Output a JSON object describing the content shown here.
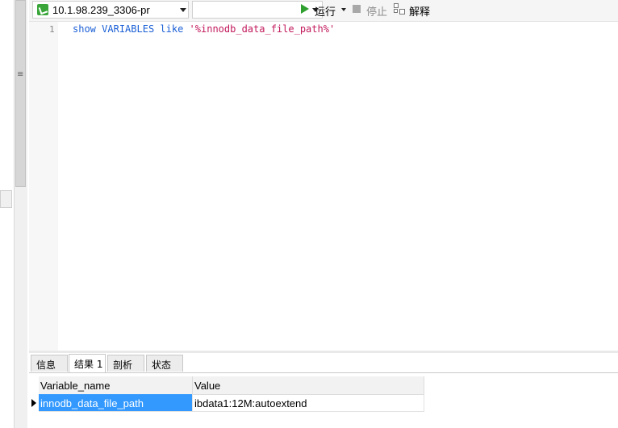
{
  "toolbar": {
    "connection": "10.1.98.239_3306-pr",
    "database": "",
    "run_label": "运行",
    "stop_label": "停止",
    "explain_label": "解释"
  },
  "editor": {
    "line_number": "1",
    "sql_keyword_1": "show",
    "sql_keyword_2": "VARIABLES",
    "sql_keyword_3": "like",
    "sql_string": "'%innodb_data_file_path%'"
  },
  "result_tabs": [
    "信息",
    "结果 1",
    "剖析",
    "状态"
  ],
  "active_tab_index": 1,
  "grid": {
    "columns": [
      "Variable_name",
      "Value"
    ],
    "rows": [
      [
        "innodb_data_file_path",
        "ibdata1:12M:autoextend"
      ]
    ]
  },
  "colors": {
    "keyword": "#1a5fd6",
    "string": "#c2185b",
    "selection": "#3399ff",
    "run_icon": "#2fa02f"
  },
  "icons": [
    "connection-icon",
    "run-icon",
    "stop-icon",
    "explain-icon",
    "dropdown-arrow-icon",
    "row-indicator-icon"
  ]
}
